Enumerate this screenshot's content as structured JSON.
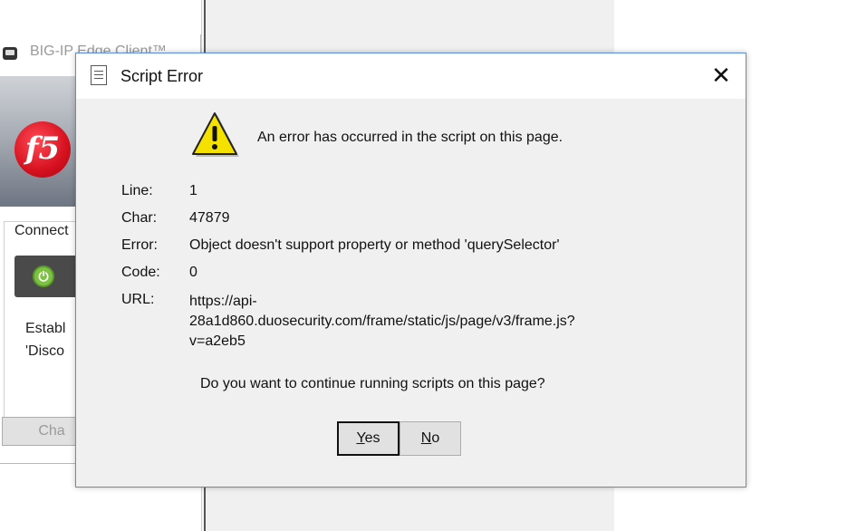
{
  "background_window": {
    "title": "BIG-IP Edge Client™",
    "logo_text": "f5",
    "connection_label": "Connect",
    "status_text": "Establ\n'Disco",
    "change_button_label": "Cha"
  },
  "dialog": {
    "title": "Script Error",
    "close_glyph": "✕",
    "message": "An error has occurred in the script on this page.",
    "details": {
      "line_label": "Line:",
      "line_value": "1",
      "char_label": "Char:",
      "char_value": "47879",
      "error_label": "Error:",
      "error_value": "Object doesn't support property or method 'querySelector'",
      "code_label": "Code:",
      "code_value": "0",
      "url_label": "URL:",
      "url_value": "https://api-\n28a1d860.duosecurity.com/frame/static/js/page/v3/frame.js?\nv=a2eb5"
    },
    "question": "Do you want to continue running scripts on this page?",
    "buttons": {
      "yes_mnemonic": "Y",
      "yes_rest": "es",
      "no_mnemonic": "N",
      "no_rest": "o"
    }
  },
  "icons": {
    "title_icon": "document-icon",
    "warning_icon": "warning-icon",
    "close_icon": "close-icon",
    "power_icon": "power-icon"
  },
  "colors": {
    "dialog_border": "#5a8dd6",
    "warning_yellow": "#f5e100",
    "f5_red": "#d6101f",
    "power_green": "#7dc242"
  }
}
